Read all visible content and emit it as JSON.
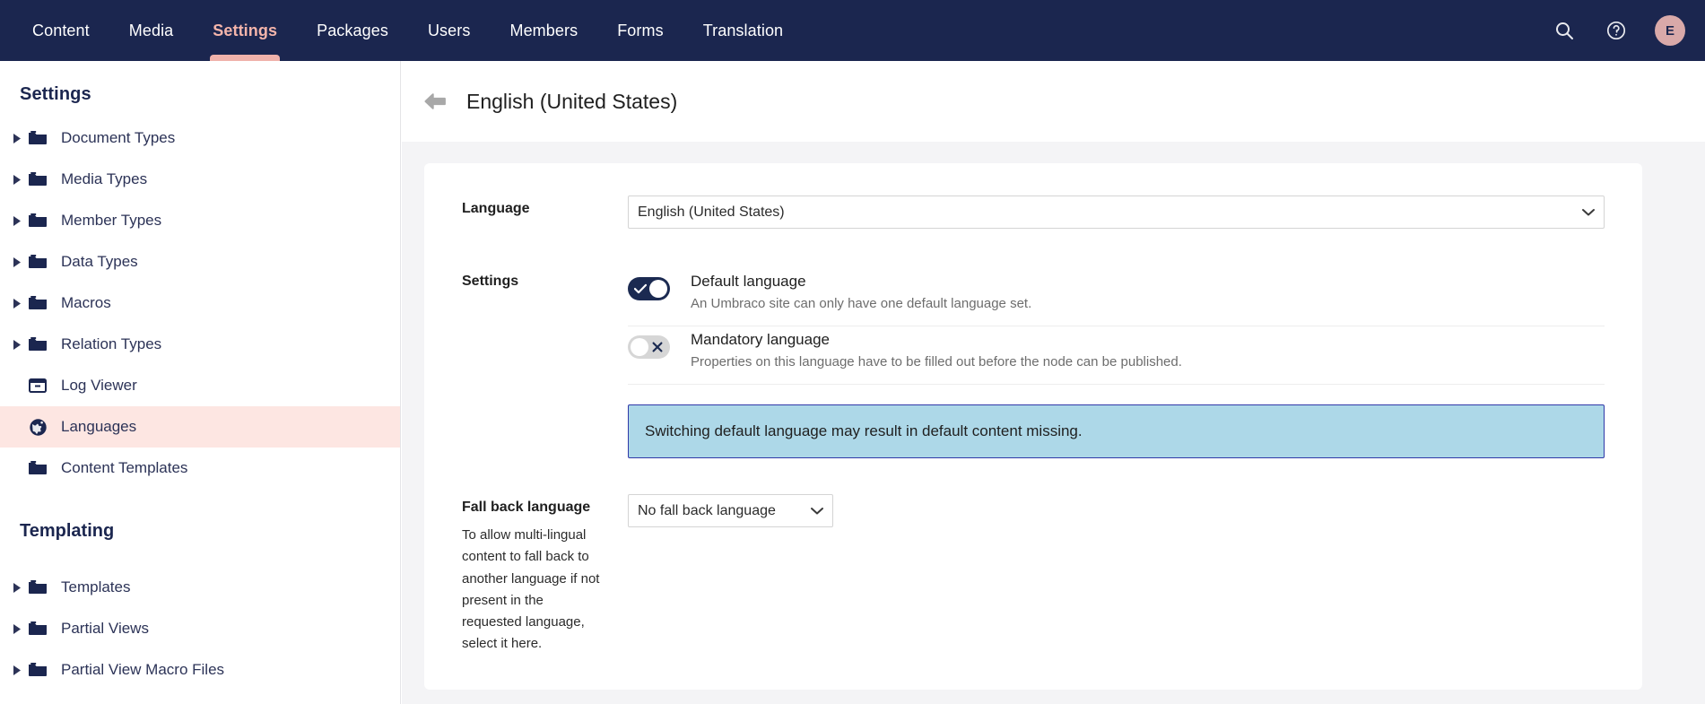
{
  "topnav": {
    "items": [
      {
        "label": "Content",
        "active": false
      },
      {
        "label": "Media",
        "active": false
      },
      {
        "label": "Settings",
        "active": true
      },
      {
        "label": "Packages",
        "active": false
      },
      {
        "label": "Users",
        "active": false
      },
      {
        "label": "Members",
        "active": false
      },
      {
        "label": "Forms",
        "active": false
      },
      {
        "label": "Translation",
        "active": false
      }
    ],
    "search_icon": "search-icon",
    "help_icon": "help-circle-icon",
    "avatar_initial": "E",
    "avatar_color": "#d9a9a9",
    "background_color": "#1b264f",
    "active_color": "#f0b2ab"
  },
  "sidebar": {
    "title": "Settings",
    "items": [
      {
        "label": "Document Types",
        "icon": "folder-icon",
        "expandable": true,
        "selected": false
      },
      {
        "label": "Media Types",
        "icon": "folder-icon",
        "expandable": true,
        "selected": false
      },
      {
        "label": "Member Types",
        "icon": "folder-icon",
        "expandable": true,
        "selected": false
      },
      {
        "label": "Data Types",
        "icon": "folder-icon",
        "expandable": true,
        "selected": false
      },
      {
        "label": "Macros",
        "icon": "folder-icon",
        "expandable": true,
        "selected": false
      },
      {
        "label": "Relation Types",
        "icon": "folder-icon",
        "expandable": true,
        "selected": false
      },
      {
        "label": "Log Viewer",
        "icon": "log-icon",
        "expandable": false,
        "selected": false
      },
      {
        "label": "Languages",
        "icon": "globe-icon",
        "expandable": false,
        "selected": true
      },
      {
        "label": "Content Templates",
        "icon": "folder-icon",
        "expandable": false,
        "selected": false
      }
    ],
    "group_title": "Templating",
    "group_items": [
      {
        "label": "Templates",
        "icon": "folder-icon",
        "expandable": true,
        "selected": false
      },
      {
        "label": "Partial Views",
        "icon": "folder-icon",
        "expandable": true,
        "selected": false
      },
      {
        "label": "Partial View Macro Files",
        "icon": "folder-icon",
        "expandable": true,
        "selected": false
      }
    ],
    "selected_background": "#fde6e2"
  },
  "main": {
    "back_icon": "back-arrow-icon",
    "page_title": "English (United States)",
    "language": {
      "label": "Language",
      "selected": "English (United States)"
    },
    "settings": {
      "label": "Settings",
      "toggles": [
        {
          "title": "Default language",
          "description": "An Umbraco site can only have one default language set.",
          "state": "on",
          "mark": "check"
        },
        {
          "title": "Mandatory language",
          "description": "Properties on this language have to be filled out before the node can be published.",
          "state": "off",
          "mark": "cross"
        }
      ],
      "info_banner": {
        "text": "Switching default language may result in default content missing.",
        "background": "#add8e8",
        "border": "#2f38a8"
      }
    },
    "fallback": {
      "label": "Fall back language",
      "description": "To allow multi-lingual content to fall back to another language if not present in the requested language, select it here.",
      "selected": "No fall back language"
    }
  }
}
